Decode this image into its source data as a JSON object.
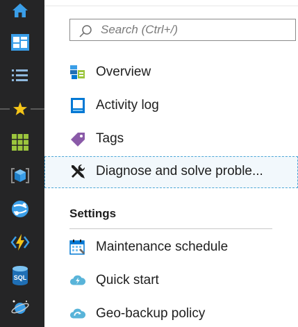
{
  "search": {
    "placeholder": "Search (Ctrl+/)"
  },
  "rail": {
    "items": [
      {
        "icon": "home-icon"
      },
      {
        "icon": "dashboard-icon"
      },
      {
        "icon": "all-services-list-icon"
      },
      {
        "icon": "favorites-star-icon"
      },
      {
        "icon": "all-resources-grid-icon"
      },
      {
        "icon": "resource-groups-cube-icon"
      },
      {
        "icon": "app-services-globe-icon"
      },
      {
        "icon": "function-apps-bolt-icon"
      },
      {
        "icon": "sql-databases-icon"
      },
      {
        "icon": "cosmos-db-planet-icon"
      }
    ],
    "sql_label": "SQL"
  },
  "menu": {
    "items": [
      {
        "label": "Overview",
        "icon": "overview-icon"
      },
      {
        "label": "Activity log",
        "icon": "activity-log-icon"
      },
      {
        "label": "Tags",
        "icon": "tag-icon"
      },
      {
        "label": "Diagnose and solve proble...",
        "icon": "wrench-screwdriver-icon",
        "selected": true
      }
    ]
  },
  "settings": {
    "heading": "Settings",
    "items": [
      {
        "label": "Maintenance schedule",
        "icon": "calendar-icon"
      },
      {
        "label": "Quick start",
        "icon": "cloud-lightning-icon"
      },
      {
        "label": "Geo-backup policy",
        "icon": "cloud-backup-icon"
      }
    ]
  },
  "colors": {
    "rail_bg": "#252526",
    "azure_blue": "#0078d4",
    "selected_bg": "#f2f8fc",
    "selected_border": "#4aa6d6"
  }
}
